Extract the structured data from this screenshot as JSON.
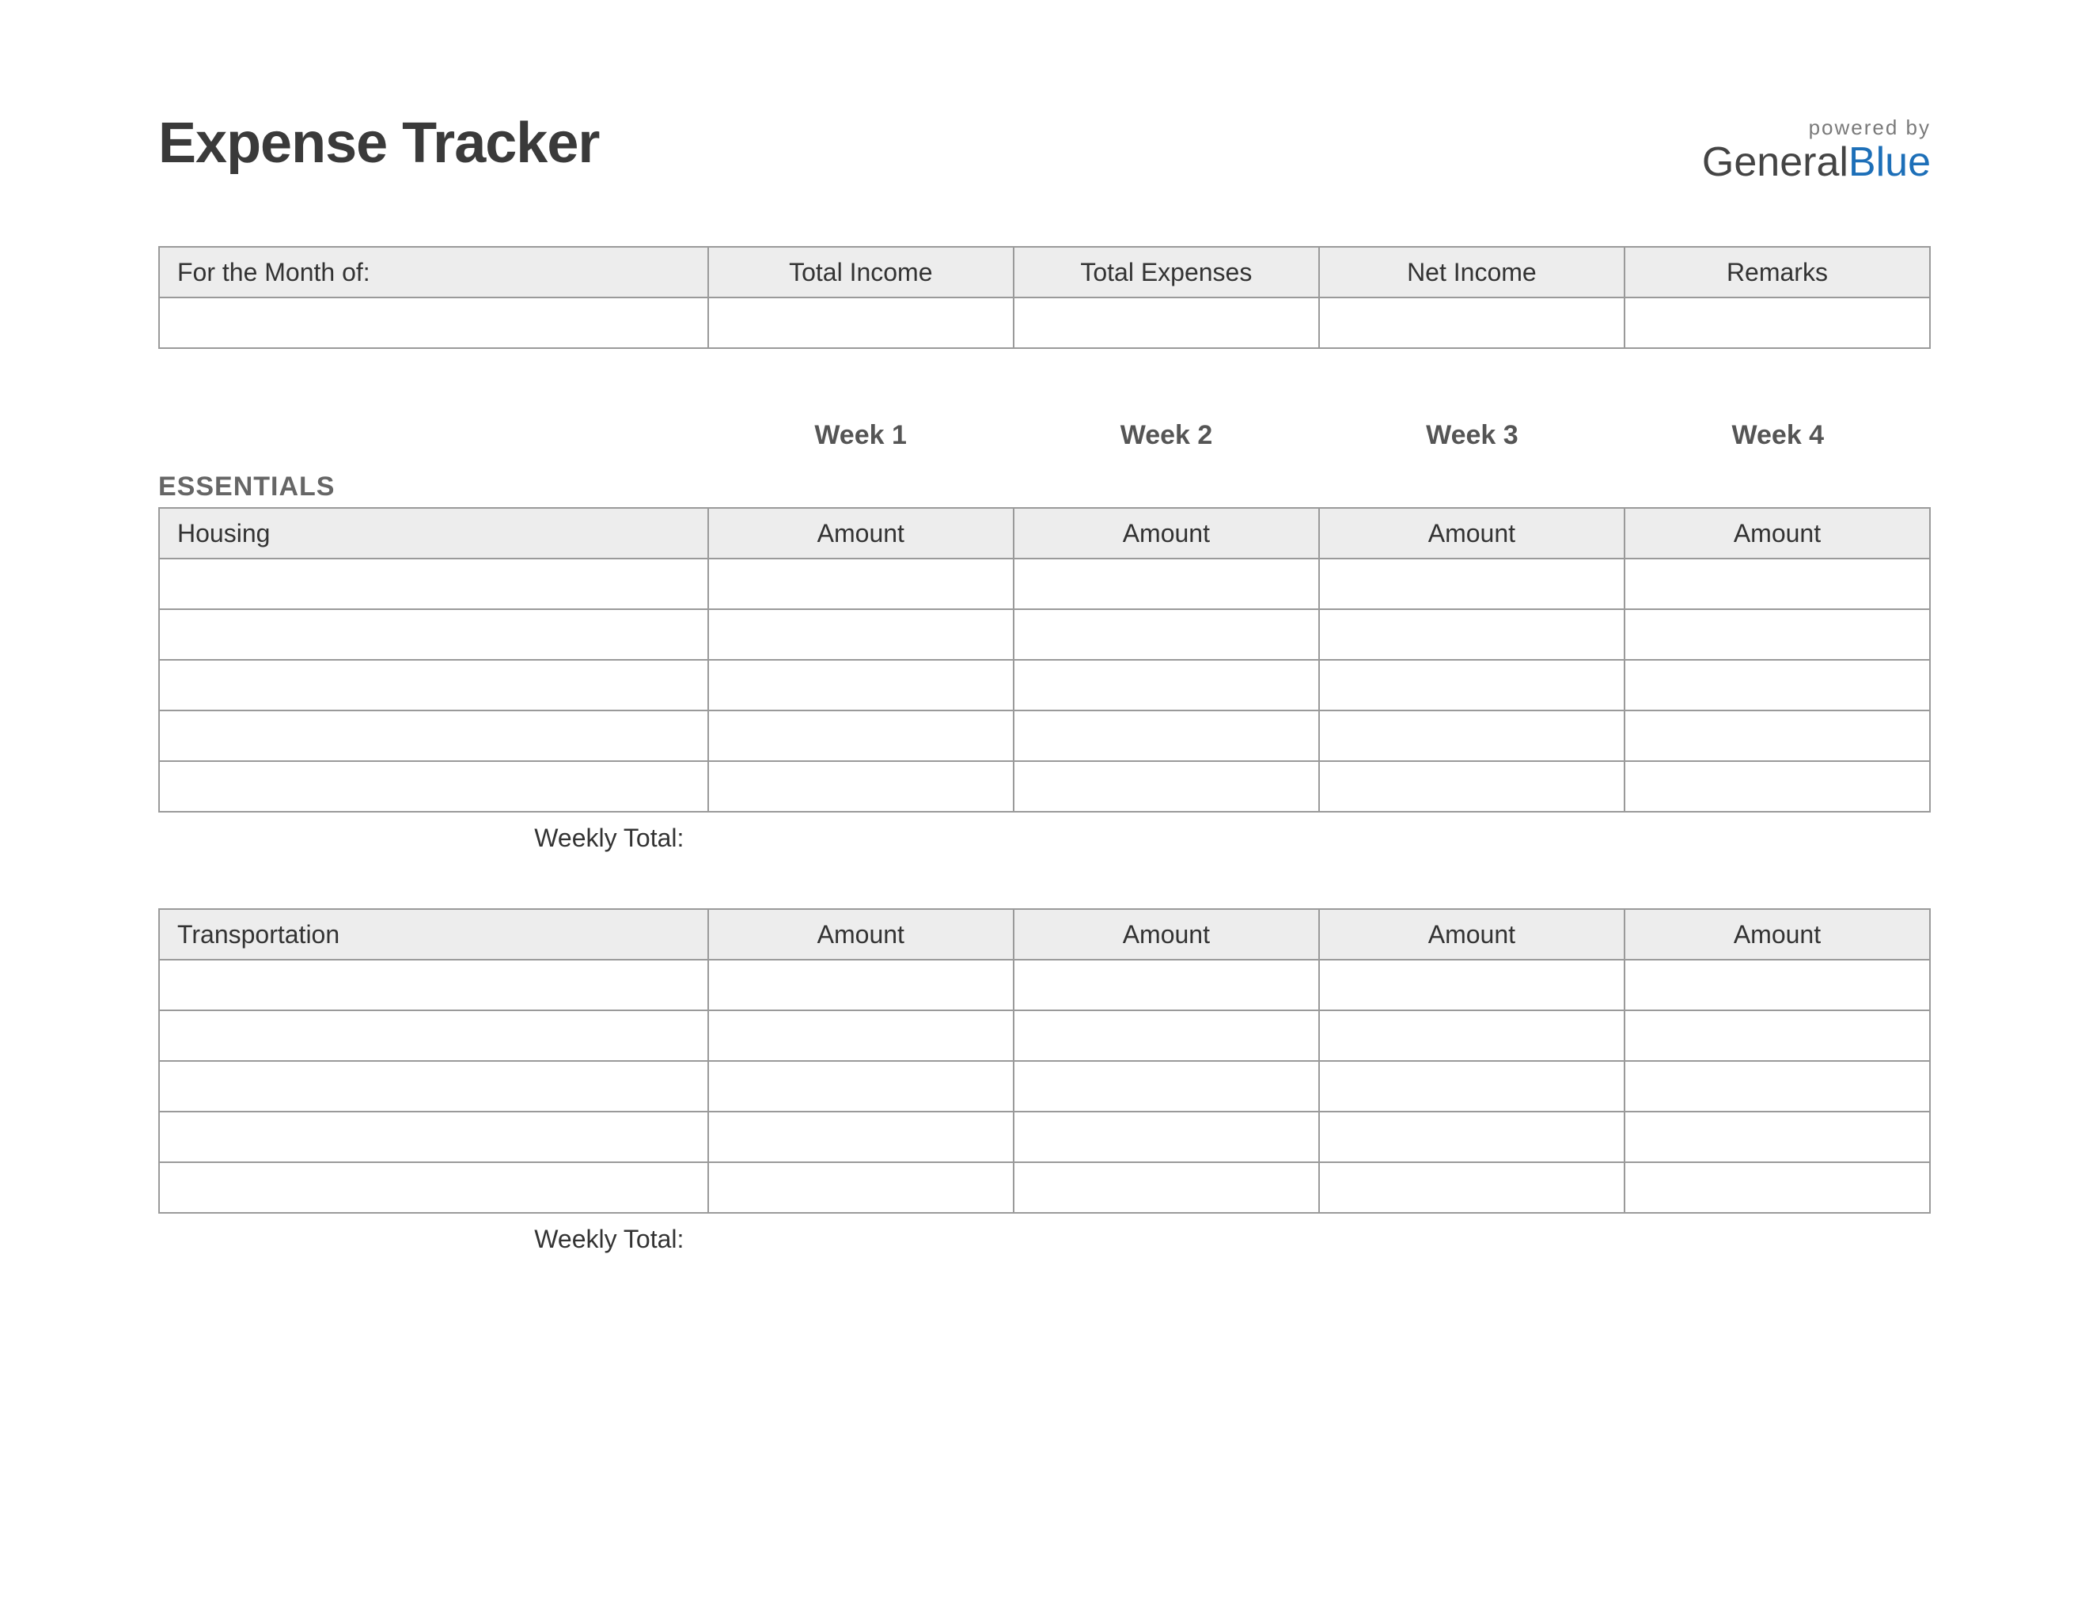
{
  "title": "Expense Tracker",
  "brand": {
    "powered": "powered by",
    "name1": "General",
    "name2": "Blue"
  },
  "summary": {
    "month_label": "For the Month of:",
    "total_income_label": "Total Income",
    "total_expenses_label": "Total Expenses",
    "net_income_label": "Net Income",
    "remarks_label": "Remarks",
    "month_value": "",
    "total_income_value": "",
    "total_expenses_value": "",
    "net_income_value": "",
    "remarks_value": ""
  },
  "weeks": {
    "w1": "Week 1",
    "w2": "Week 2",
    "w3": "Week 3",
    "w4": "Week 4"
  },
  "section_essentials": "ESSENTIALS",
  "amount_label": "Amount",
  "weekly_total_label": "Weekly Total:",
  "categories": {
    "housing": {
      "label": "Housing",
      "rows": [
        {
          "desc": "",
          "a1": "",
          "a2": "",
          "a3": "",
          "a4": ""
        },
        {
          "desc": "",
          "a1": "",
          "a2": "",
          "a3": "",
          "a4": ""
        },
        {
          "desc": "",
          "a1": "",
          "a2": "",
          "a3": "",
          "a4": ""
        },
        {
          "desc": "",
          "a1": "",
          "a2": "",
          "a3": "",
          "a4": ""
        },
        {
          "desc": "",
          "a1": "",
          "a2": "",
          "a3": "",
          "a4": ""
        }
      ]
    },
    "transportation": {
      "label": "Transportation",
      "rows": [
        {
          "desc": "",
          "a1": "",
          "a2": "",
          "a3": "",
          "a4": ""
        },
        {
          "desc": "",
          "a1": "",
          "a2": "",
          "a3": "",
          "a4": ""
        },
        {
          "desc": "",
          "a1": "",
          "a2": "",
          "a3": "",
          "a4": ""
        },
        {
          "desc": "",
          "a1": "",
          "a2": "",
          "a3": "",
          "a4": ""
        },
        {
          "desc": "",
          "a1": "",
          "a2": "",
          "a3": "",
          "a4": ""
        }
      ]
    }
  }
}
